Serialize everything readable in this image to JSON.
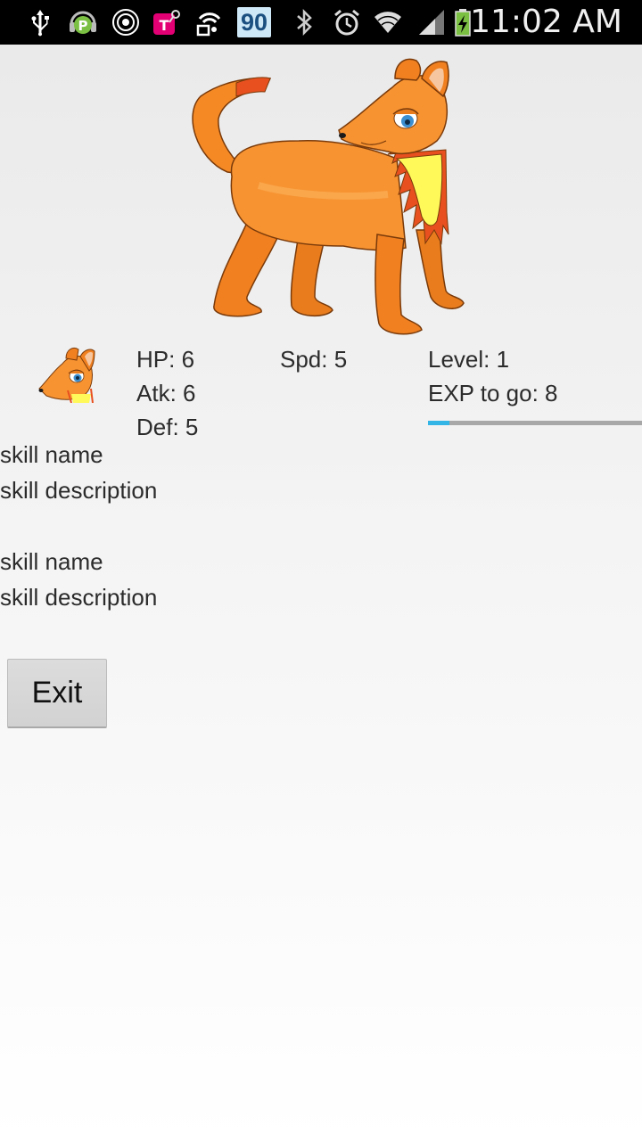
{
  "status_bar": {
    "time": "11:02 AM",
    "badge": "90",
    "icons": [
      "usb-icon",
      "headphones-app-icon",
      "nfc-icon",
      "tmobile-icon",
      "hotspot-icon",
      "badge-90-icon",
      "bluetooth-icon",
      "alarm-icon",
      "wifi-icon",
      "signal-icon",
      "battery-charging-icon"
    ]
  },
  "creature": {
    "image": "orange-fox-creature"
  },
  "stats": {
    "hp": "HP: 6",
    "atk": "Atk: 6",
    "def": "Def: 5",
    "spd": "Spd: 5",
    "level": "Level: 1",
    "exp_to_go": "EXP to go: 8",
    "exp_progress": 0.1
  },
  "skills": [
    {
      "name": "skill name",
      "description": "skill description"
    },
    {
      "name": "skill name",
      "description": "skill description"
    }
  ],
  "exit_button": {
    "label": "Exit"
  },
  "colors": {
    "accent": "#33b5e5",
    "creature_orange": "#f58a25",
    "status_bar": "#000000"
  }
}
